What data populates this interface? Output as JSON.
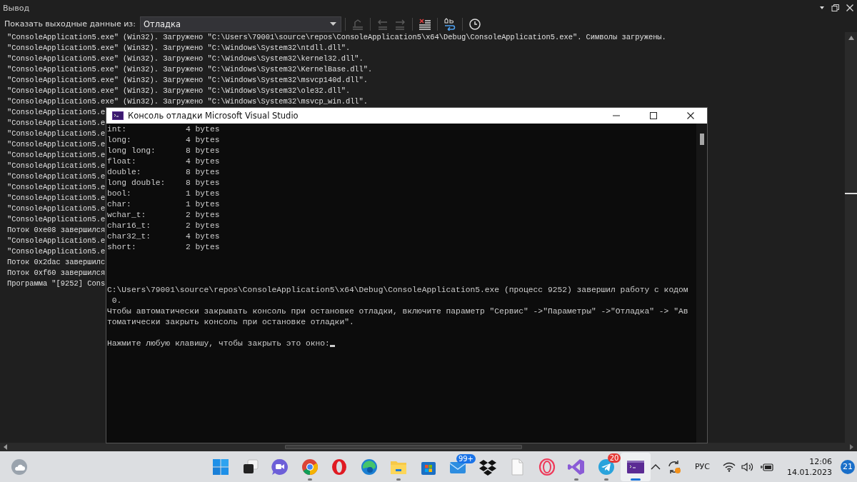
{
  "output_panel": {
    "title": "Вывод",
    "source_label": "Показать выходные данные из:",
    "source_value": "Отладка",
    "toolbar": [
      {
        "kind": "goto",
        "disabled": true
      },
      {
        "kind": "prev",
        "disabled": true
      },
      {
        "kind": "next",
        "disabled": true
      },
      {
        "kind": "clear",
        "disabled": false
      },
      {
        "kind": "wrap",
        "disabled": false
      },
      {
        "kind": "clock",
        "disabled": false
      }
    ],
    "lines": [
      "\"ConsoleApplication5.exe\" (Win32). Загружено \"C:\\Users\\79001\\source\\repos\\ConsoleApplication5\\x64\\Debug\\ConsoleApplication5.exe\". Символы загружены.",
      "\"ConsoleApplication5.exe\" (Win32). Загружено \"C:\\Windows\\System32\\ntdll.dll\".",
      "\"ConsoleApplication5.exe\" (Win32). Загружено \"C:\\Windows\\System32\\kernel32.dll\".",
      "\"ConsoleApplication5.exe\" (Win32). Загружено \"C:\\Windows\\System32\\KernelBase.dll\".",
      "\"ConsoleApplication5.exe\" (Win32). Загружено \"C:\\Windows\\System32\\msvcp140d.dll\".",
      "\"ConsoleApplication5.exe\" (Win32). Загружено \"C:\\Windows\\System32\\ole32.dll\".",
      "\"ConsoleApplication5.exe\" (Win32). Загружено \"C:\\Windows\\System32\\msvcp_win.dll\".",
      "\"ConsoleApplication5.e",
      "\"ConsoleApplication5.e",
      "\"ConsoleApplication5.e",
      "\"ConsoleApplication5.e",
      "\"ConsoleApplication5.e",
      "\"ConsoleApplication5.e",
      "\"ConsoleApplication5.e",
      "\"ConsoleApplication5.e",
      "\"ConsoleApplication5.e",
      "\"ConsoleApplication5.e",
      "\"ConsoleApplication5.e",
      "Поток 0xe08 завершился",
      "\"ConsoleApplication5.e",
      "\"ConsoleApplication5.e",
      "Поток 0x2dac завершилс",
      "Поток 0xf60 завершился",
      "Программа \"[9252] Cons"
    ]
  },
  "console_window": {
    "title": "Консоль отладки Microsoft Visual Studio",
    "sizes": [
      {
        "name": "int:",
        "value": "4 bytes"
      },
      {
        "name": "long:",
        "value": "4 bytes"
      },
      {
        "name": "long long:",
        "value": "8 bytes"
      },
      {
        "name": "float:",
        "value": "4 bytes"
      },
      {
        "name": "double:",
        "value": "8 bytes"
      },
      {
        "name": "long double:",
        "value": "8 bytes"
      },
      {
        "name": "bool:",
        "value": "1 bytes"
      },
      {
        "name": "char:",
        "value": "1 bytes"
      },
      {
        "name": "wchar_t:",
        "value": "2 bytes"
      },
      {
        "name": "char16_t:",
        "value": "2 bytes"
      },
      {
        "name": "char32_t:",
        "value": "4 bytes"
      },
      {
        "name": "short:",
        "value": "2 bytes"
      }
    ],
    "messages": [
      "C:\\Users\\79001\\source\\repos\\ConsoleApplication5\\x64\\Debug\\ConsoleApplication5.exe (процесс 9252) завершил работу с кодом",
      " 0.",
      "Чтобы автоматически закрывать консоль при остановке отладки, включите параметр \"Сервис\" ->\"Параметры\" ->\"Отладка\" -> \"Ав",
      "томатически закрыть консоль при остановке отладки\"."
    ],
    "prompt": "Нажмите любую клавишу, чтобы закрыть это окно:"
  },
  "taskbar": {
    "apps": [
      {
        "kind": "start",
        "running": false,
        "active": false
      },
      {
        "kind": "taskview",
        "running": false,
        "active": false
      },
      {
        "kind": "chat",
        "running": false,
        "active": false
      },
      {
        "kind": "chrome",
        "running": true,
        "active": false
      },
      {
        "kind": "opera",
        "running": false,
        "active": false
      },
      {
        "kind": "edge",
        "running": false,
        "active": false
      },
      {
        "kind": "explorer",
        "running": true,
        "active": false
      },
      {
        "kind": "store",
        "running": false,
        "active": false
      },
      {
        "kind": "mail",
        "running": false,
        "active": false,
        "badge": "99+"
      },
      {
        "kind": "dropbox",
        "running": false,
        "active": false
      },
      {
        "kind": "file",
        "running": false,
        "active": false
      },
      {
        "kind": "operagx",
        "running": false,
        "active": false
      },
      {
        "kind": "vs",
        "running": true,
        "active": false
      },
      {
        "kind": "telegram",
        "running": true,
        "active": false,
        "badge": "20"
      },
      {
        "kind": "console",
        "running": true,
        "active": true
      }
    ],
    "language": "РУС",
    "time": "12:06",
    "date": "14.01.2023",
    "notifications": "21"
  }
}
